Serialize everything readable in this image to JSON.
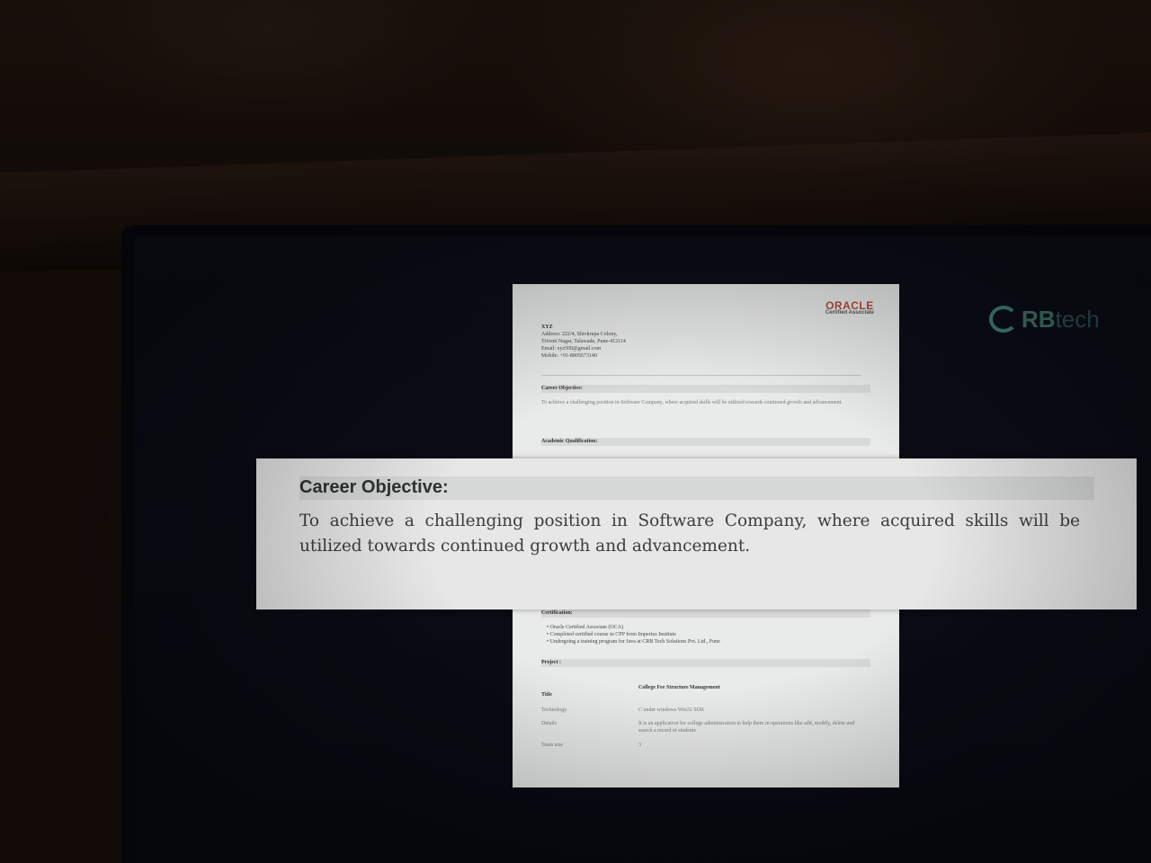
{
  "brand": {
    "logo_text_main": "RB",
    "logo_text_rest": "tech"
  },
  "resume": {
    "oracle_logo": "ORACLE",
    "oracle_sub": "Certified Associate",
    "contact": [
      "XYZ",
      "Address: 222/4, Shivkrupa Colony,",
      "Triveni Nagar, Talawade, Pune-412114",
      "Email: xyz500@gmail.com",
      "Mobile: +91-8805673140"
    ],
    "career_heading": "Career Objective:",
    "career_text": "To achieve a challenging position in Software Company, where acquired skills will be utilized towards continued growth and advancement.",
    "academic_heading": "Academic Qualification:",
    "cert_heading": "Certification:",
    "cert_items": [
      "Oracle Certified Associate (OCA)",
      "Completed certified course in CPP from Imperius Institute",
      "Undergoing a training program for Java at CRB Tech Solutions Pvt. Ltd., Pune"
    ],
    "project_heading": "Project :",
    "project": {
      "title_key": "Title",
      "title_val": "College Fee Structure Management",
      "tech_key": "Technology",
      "tech_val": "C under windows Win32 SDK",
      "details_key": "Details",
      "details_val": "It is an application for college administration to help them in operations like add, modify, delete and search a record of students",
      "team_key": "Team size",
      "team_val": "3"
    }
  },
  "zoom": {
    "heading": "Career Objective:",
    "body": "To achieve a challenging position in Software Company, where acquired skills will be utilized towards continued growth and advancement."
  }
}
